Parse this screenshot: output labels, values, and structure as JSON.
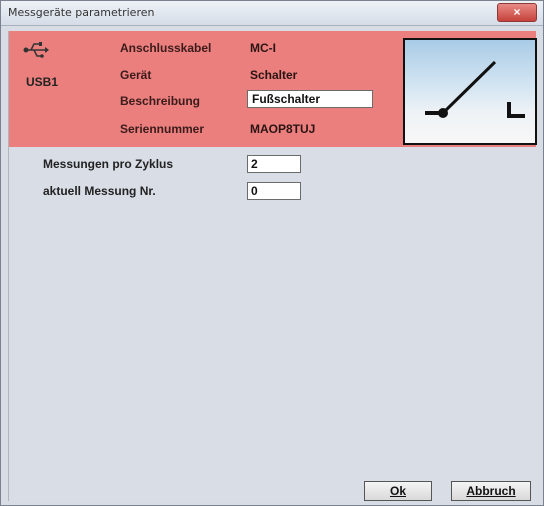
{
  "window": {
    "title": "Messgeräte parametrieren",
    "close_glyph": "×"
  },
  "device": {
    "port_icon": "usb-icon",
    "port_label": "USB1",
    "fields": [
      {
        "label": "Anschlusskabel",
        "value": "MC-I"
      },
      {
        "label": "Gerät",
        "value": "Schalter"
      },
      {
        "label": "Beschreibung",
        "value": "Fußschalter"
      },
      {
        "label": "Seriennummer",
        "value": "MAOP8TUJ"
      }
    ],
    "header_color": "#ea7f7d"
  },
  "params": [
    {
      "label": "Messungen pro Zyklus",
      "value": "2"
    },
    {
      "label": "aktuell Messung Nr.",
      "value": "0"
    }
  ],
  "buttons": {
    "ok_label": "Ok",
    "cancel_label": "Abbruch"
  }
}
